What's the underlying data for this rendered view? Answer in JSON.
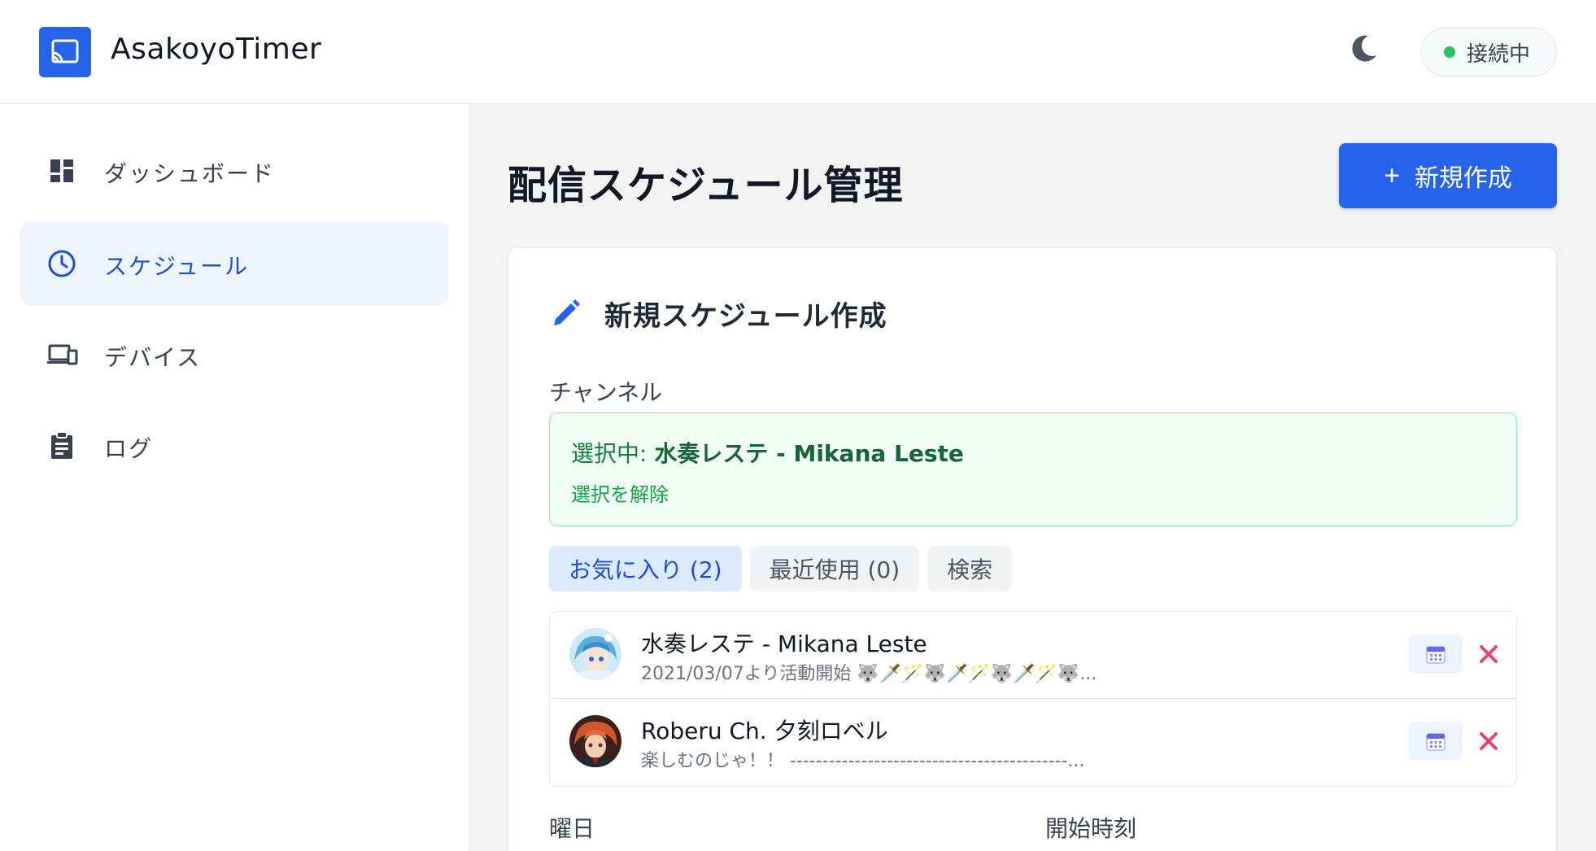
{
  "header": {
    "app_title": "AsakoyoTimer",
    "connection_status": "接続中",
    "colors": {
      "brand": "#2563eb",
      "status_online": "#22c55e"
    }
  },
  "sidebar": {
    "items": [
      {
        "label": "ダッシュボード",
        "icon": "dashboard-icon",
        "active": false
      },
      {
        "label": "スケジュール",
        "icon": "clock-icon",
        "active": true
      },
      {
        "label": "デバイス",
        "icon": "devices-icon",
        "active": false
      },
      {
        "label": "ログ",
        "icon": "clipboard-icon",
        "active": false
      }
    ]
  },
  "main": {
    "page_title": "配信スケジュール管理",
    "new_button": {
      "plus": "+",
      "label": "新規作成"
    },
    "form": {
      "title": "新規スケジュール作成",
      "channel_label": "チャンネル",
      "selected_prefix": "選択中: ",
      "selected_channel": "水奏レステ - Mikana Leste",
      "deselect_label": "選択を解除",
      "tabs": [
        {
          "label": "お気に入り (2)",
          "active": true
        },
        {
          "label": "最近使用 (0)",
          "active": false
        },
        {
          "label": "検索",
          "active": false
        }
      ],
      "channels": [
        {
          "name": "水奏レステ - Mikana Leste",
          "description": "2021/03/07より活動開始 🐺🗡️🪄🐺🗡️🪄🐺🗡️🪄🐺..."
        },
        {
          "name": "Roberu Ch. 夕刻ロベル",
          "description": "楽しむのじゃ！！ -------------------------------------------..."
        }
      ],
      "weekday_label": "曜日",
      "start_time_label": "開始時刻"
    }
  }
}
